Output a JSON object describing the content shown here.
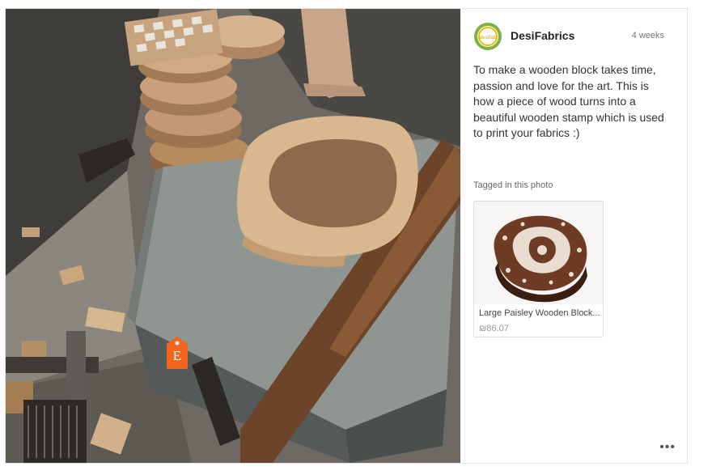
{
  "post": {
    "shop_name": "DesiFabrics",
    "time_ago": "4 weeks",
    "caption": "To make a wooden block takes time, passion and love for the art. This is how a piece of wood turns into a beautiful wooden stamp which is used to print your fabrics :)",
    "avatar_text": "desifab",
    "etsy_tag_letter": "E"
  },
  "tagged": {
    "label": "Tagged in this photo",
    "product": {
      "title": "Large Paisley Wooden Block...",
      "price": "₪86.07"
    }
  },
  "actions": {
    "more_label": "•••"
  },
  "colors": {
    "etsy_orange": "#f1641e",
    "avatar_green": "#7cb342",
    "avatar_gold": "#f5b800"
  },
  "icons": [
    "etsy-price-tag-icon",
    "shop-avatar-logo",
    "more-options-icon"
  ]
}
